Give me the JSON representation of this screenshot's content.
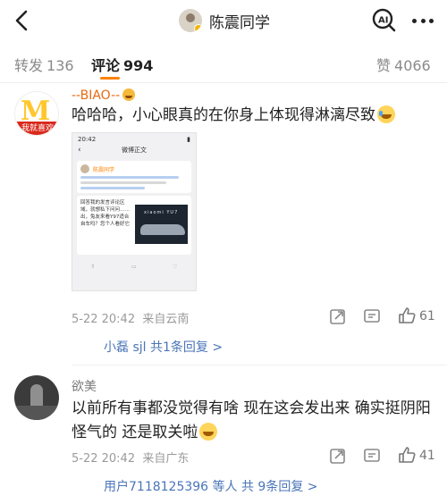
{
  "header": {
    "title": "陈震同学",
    "ai_label": "AI"
  },
  "tabs": {
    "repost": {
      "label": "转发",
      "count": "136"
    },
    "comments": {
      "label": "评论",
      "count": "994"
    },
    "likes": {
      "label": "赞",
      "count": "4066"
    }
  },
  "comments": [
    {
      "username": "--BIAO--",
      "avatar_text": "我就喜欢",
      "text": "哈哈哈，小心眼真的在你身上体现得淋漓尽致",
      "timestamp": "5-22 20:42",
      "location": "来自云南",
      "likes": "61",
      "replies_preview": "小磊 sjl  共1条回复 >",
      "screenshot": {
        "status_time": "20:42",
        "nav_title": "微博正文",
        "poster": "陈震同学",
        "post_text": "回答我的发言评论区域，就想私下问问……出，兔友来看Y97适合自车吗？您个人看好它",
        "car_brand": "xiaomi YU7"
      }
    },
    {
      "username": "欲美",
      "text_line1": "以前所有事都没觉得有啥 现在这会发出来 确实挺阴阳",
      "text_line2": "怪气的 还是取关啦",
      "timestamp": "5-22 20:42",
      "location": "来自广东",
      "likes": "41",
      "replies_preview": "用户7118125396 等人  共 9条回复 >"
    }
  ],
  "colors": {
    "accent": "#ff8200",
    "link": "#4a75b8",
    "username_highlight": "#e86a12"
  }
}
